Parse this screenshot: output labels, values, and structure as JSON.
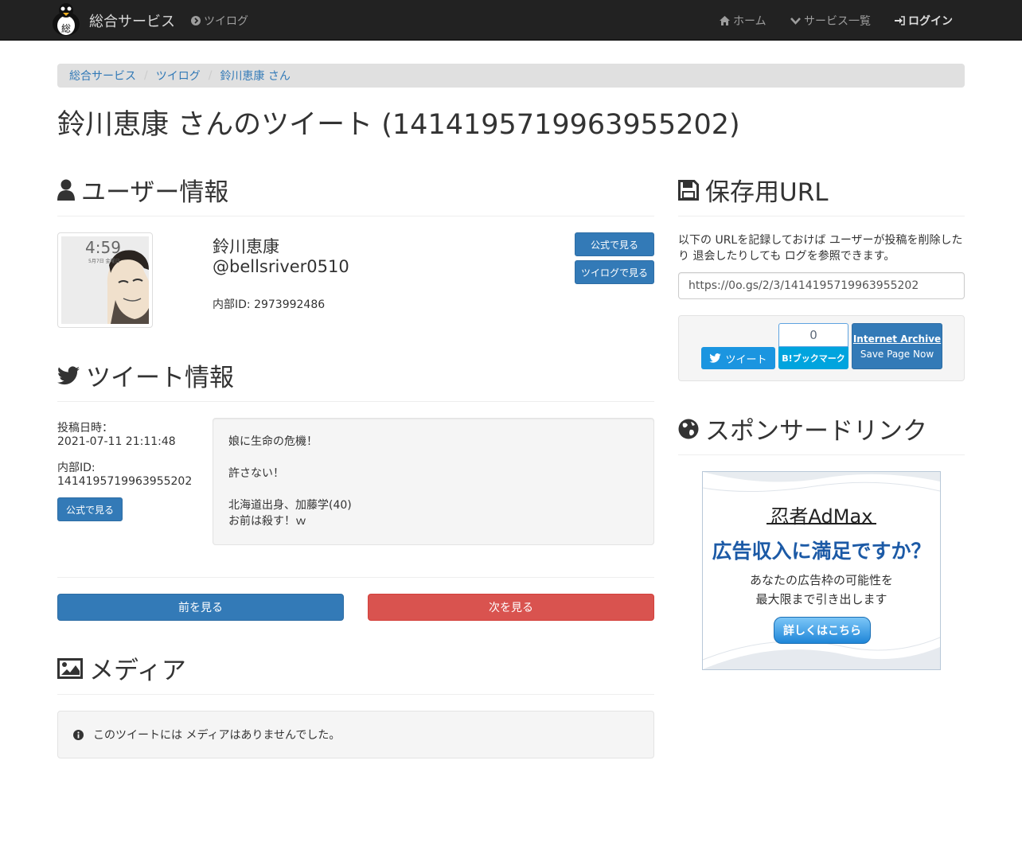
{
  "navbar": {
    "brand": "総合サービス",
    "twilog_link": "ツイログ",
    "home": "ホーム",
    "services": "サービス一覧",
    "login": "ログイン"
  },
  "breadcrumb": {
    "items": [
      "総合サービス",
      "ツイログ",
      "鈴川恵康 さん"
    ]
  },
  "page_title": "鈴川恵康 さんのツイート (1414195719963955202)",
  "user_section": {
    "heading": "ユーザー情報",
    "name": "鈴川恵康",
    "screen_name": "@bellsriver0510",
    "internal_id": "内部ID: 2973992486",
    "view_official": "公式で見る",
    "view_twilog": "ツイログで見る",
    "avatar_time": "4:59",
    "avatar_date": "5月7日 金曜日"
  },
  "tweet_section": {
    "heading": "ツイート情報",
    "posted_label": "投稿日時：",
    "posted_value": "2021-07-11 21:11:48",
    "internal_id_label": "内部ID:",
    "internal_id_value": "1414195719963955202",
    "view_official": "公式で見る",
    "lines": [
      "娘に生命の危機！",
      "",
      "許さない！",
      "",
      "北海道出身、加藤学(40)",
      "お前は殺す！ｗ"
    ]
  },
  "pager": {
    "prev": "前を見る",
    "next": "次を見る"
  },
  "media_section": {
    "heading": "メディア",
    "empty_message": "このツイートには メディアはありませんでした。"
  },
  "save_section": {
    "heading": "保存用URL",
    "description": "以下の URLを記録しておけば ユーザーが投稿を削除したり 退会したりしても ログを参照できます。",
    "url": "https://0o.gs/2/3/1414195719963955202",
    "tweet_button": "ツイート",
    "hatena_count": "0",
    "hatena_button": "B!ブックマーク",
    "archive_title": "Internet Archive",
    "archive_action": "Save Page Now"
  },
  "sponsor_section": {
    "heading": "スポンサードリンク",
    "ad_logo": "忍者AdMax",
    "ad_headline": "広告収入に満足ですか？",
    "ad_line1": "あなたの広告枠の可能性を",
    "ad_line2": "最大限まで引き出します",
    "ad_button": "詳しくはこちら"
  },
  "colors": {
    "navbar_bg": "#222222",
    "primary": "#337ab7",
    "danger": "#d9534f",
    "twitter": "#1b95e0",
    "hatena": "#00a4de"
  }
}
